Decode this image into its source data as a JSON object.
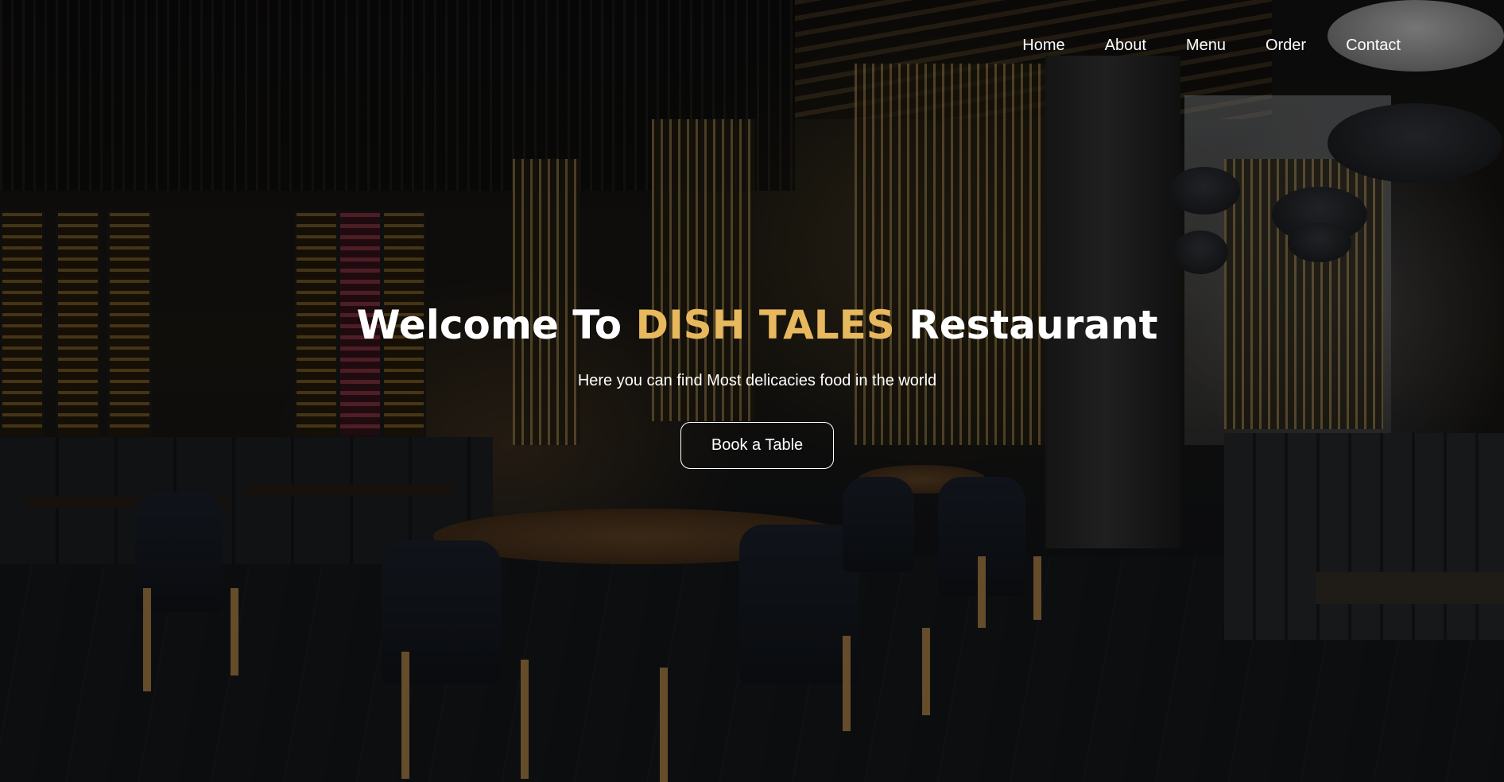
{
  "nav": {
    "items": [
      {
        "label": "Home"
      },
      {
        "label": "About"
      },
      {
        "label": "Menu"
      },
      {
        "label": "Order"
      },
      {
        "label": "Contact"
      }
    ]
  },
  "hero": {
    "title_prefix": "Welcome To ",
    "title_highlight": "DISH TALES",
    "title_suffix": " Restaurant",
    "subtitle": "Here you can find Most delicacies food in the world",
    "cta_label": "Book a Table",
    "background_image": "restaurant interior with wooden tables, dark chairs and bamboo partitions"
  },
  "colors": {
    "accent": "#e8b85e",
    "text": "#ffffff",
    "overlay": "rgba(0,0,0,0.45)"
  }
}
